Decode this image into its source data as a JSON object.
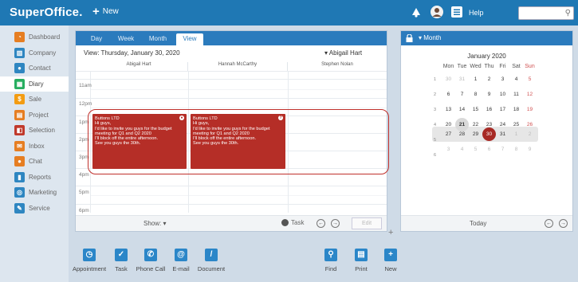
{
  "app": {
    "logo": "SuperOffice.",
    "new_label": "New",
    "help_label": "Help",
    "search_placeholder": ""
  },
  "sidebar": {
    "items": [
      {
        "label": "Dashboard",
        "icon": "dashboard-icon",
        "color": "#e67e22"
      },
      {
        "label": "Company",
        "icon": "company-icon",
        "color": "#2e86c1"
      },
      {
        "label": "Contact",
        "icon": "contact-icon",
        "color": "#2e86c1"
      },
      {
        "label": "Diary",
        "icon": "diary-icon",
        "color": "#27ae60"
      },
      {
        "label": "Sale",
        "icon": "sale-icon",
        "color": "#f39c12"
      },
      {
        "label": "Project",
        "icon": "project-icon",
        "color": "#e67e22"
      },
      {
        "label": "Selection",
        "icon": "selection-icon",
        "color": "#c0392b"
      },
      {
        "label": "Inbox",
        "icon": "inbox-icon",
        "color": "#e67e22"
      },
      {
        "label": "Chat",
        "icon": "chat-icon",
        "color": "#e67e22"
      },
      {
        "label": "Reports",
        "icon": "reports-icon",
        "color": "#2e86c1"
      },
      {
        "label": "Marketing",
        "icon": "marketing-icon",
        "color": "#2e86c1"
      },
      {
        "label": "Service",
        "icon": "service-icon",
        "color": "#2e86c1"
      }
    ],
    "active": "Diary"
  },
  "calendar": {
    "tabs": [
      "Day",
      "Week",
      "Month",
      "View"
    ],
    "active_tab": "View",
    "view_line": "View: Thursday, January 30, 2020",
    "view_user": "▾ Abigail Hart",
    "columns": [
      "Abigail Hart",
      "Hannah McCarthy",
      "Stephen Nolan"
    ],
    "times": [
      "11am",
      "12pm",
      "1pm",
      "2pm",
      "3pm",
      "4pm",
      "5pm",
      "6pm"
    ],
    "appointments": [
      {
        "title": "Buttons LTD",
        "lines": [
          "Hi guys,",
          "I'd like to invite you guys for the budget",
          "meeting for Q1 and Q2 2020",
          "I'll block off the entire afternoon.",
          "See you guys the 30th."
        ]
      },
      {
        "title": "Buttons LTD",
        "lines": [
          "Hi guys,",
          "I'd like to invite you guys for the budget",
          "meeting for Q1 and Q2 2020",
          "I'll block off the entire afternoon.",
          "See you guys the 30th."
        ]
      }
    ],
    "footer": {
      "show": "Show: ▾",
      "task": "Task",
      "edit": "Edit"
    }
  },
  "mini_calendar": {
    "header": "▾ Month",
    "month": "January 2020",
    "weekdays": [
      "Mon",
      "Tue",
      "Wed",
      "Thu",
      "Fri",
      "Sat",
      "Sun"
    ],
    "week_numbers": [
      "1",
      "2",
      "3",
      "4",
      "5",
      "6"
    ],
    "weeks": [
      [
        "30",
        "31",
        "1",
        "2",
        "3",
        "4",
        "5"
      ],
      [
        "6",
        "7",
        "8",
        "9",
        "10",
        "11",
        "12"
      ],
      [
        "13",
        "14",
        "15",
        "16",
        "17",
        "18",
        "19"
      ],
      [
        "20",
        "21",
        "22",
        "23",
        "24",
        "25",
        "26"
      ],
      [
        "27",
        "28",
        "29",
        "30",
        "31",
        "1",
        "2"
      ],
      [
        "3",
        "4",
        "5",
        "6",
        "7",
        "8",
        "9"
      ]
    ],
    "today": "21",
    "selected": "30",
    "footer_label": "Today"
  },
  "actions": [
    {
      "label": "Appointment",
      "icon": "appointment-icon"
    },
    {
      "label": "Task",
      "icon": "task-icon"
    },
    {
      "label": "Phone Call",
      "icon": "phone-call-icon"
    },
    {
      "label": "E-mail",
      "icon": "email-icon"
    },
    {
      "label": "Document",
      "icon": "document-icon"
    },
    {
      "label": "Find",
      "icon": "find-icon"
    },
    {
      "label": "Print",
      "icon": "print-icon"
    },
    {
      "label": "New",
      "icon": "new-icon"
    }
  ],
  "colors": {
    "topbar": "#1f78b4",
    "accent": "#2b7bbd",
    "appointment": "#b52e27",
    "selected_day": "#a72a25"
  }
}
